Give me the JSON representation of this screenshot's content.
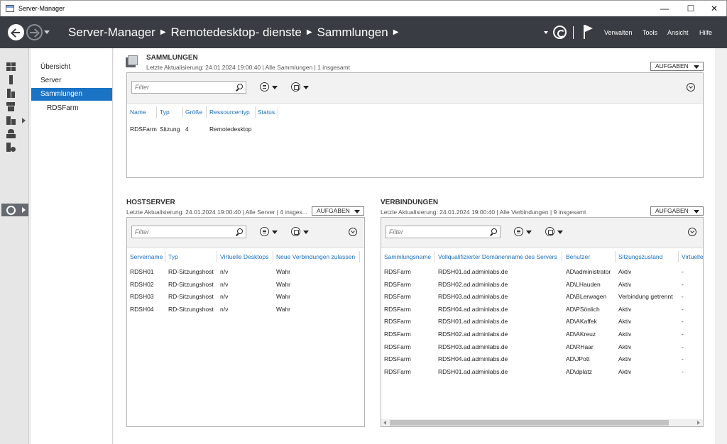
{
  "window": {
    "title": "Server-Manager",
    "minimize": "—",
    "maximize": "☐",
    "close": "✕"
  },
  "header": {
    "breadcrumb": [
      "Server-Manager",
      "Remotedesktop- dienste",
      "Sammlungen"
    ],
    "menus": [
      "Verwalten",
      "Tools",
      "Ansicht",
      "Hilfe"
    ]
  },
  "leftnav": {
    "items": [
      {
        "label": "Übersicht",
        "selected": false
      },
      {
        "label": "Server",
        "selected": false
      },
      {
        "label": "Sammlungen",
        "selected": true
      },
      {
        "label": "RDSFarm",
        "selected": false,
        "sub": true
      }
    ]
  },
  "sammlungen": {
    "title": "SAMMLUNGEN",
    "subtitle": "Letzte Aktualisierung: 24.01.2024 19:00:40 | Alle Sammlungen  | 1 insgesamt",
    "tasks": "AUFGABEN",
    "filter_placeholder": "Filter",
    "columns": [
      "Name",
      "Typ",
      "Größe",
      "Ressourcentyp",
      "Status"
    ],
    "rows": [
      [
        "RDSFarm",
        "Sitzung",
        "4",
        "Remotedesktop",
        ""
      ]
    ]
  },
  "hostserver": {
    "title": "HOSTSERVER",
    "subtitle": "Letzte Aktualisierung: 24.01.2024 19:00:40 | Alle Server  | 4 insges...",
    "tasks": "AUFGABEN",
    "filter_placeholder": "Filter",
    "columns": [
      "Servername",
      "Typ",
      "Virtuelle Desktops",
      "Neue Verbindungen zulassen"
    ],
    "rows": [
      [
        "RDSH01",
        "RD-Sitzungshost",
        "n/v",
        "Wahr"
      ],
      [
        "RDSH02",
        "RD-Sitzungshost",
        "n/v",
        "Wahr"
      ],
      [
        "RDSH03",
        "RD-Sitzungshost",
        "n/v",
        "Wahr"
      ],
      [
        "RDSH04",
        "RD-Sitzungshost",
        "n/v",
        "Wahr"
      ]
    ]
  },
  "verbindungen": {
    "title": "VERBINDUNGEN",
    "subtitle": "Letzte Aktualisierung: 24.01.2024 19:00:40 | Alle Verbindungen  | 9 insgesamt",
    "tasks": "AUFGABEN",
    "filter_placeholder": "Filter",
    "columns": [
      "Sammlungsname",
      "Vollqualifizierter Domänenname des Servers",
      "Benutzer",
      "Sitzungszustand",
      "Virtuelle"
    ],
    "rows": [
      [
        "RDSFarm",
        "RDSH01.ad.adminlabs.de",
        "AD\\administrator",
        "Aktiv",
        "-"
      ],
      [
        "RDSFarm",
        "RDSH02.ad.adminlabs.de",
        "AD\\LHauden",
        "Aktiv",
        "-"
      ],
      [
        "RDSFarm",
        "RDSH03.ad.adminlabs.de",
        "AD\\BLerwagen",
        "Verbindung getrennt",
        "-"
      ],
      [
        "RDSFarm",
        "RDSH04.ad.adminlabs.de",
        "AD\\PSönlich",
        "Aktiv",
        "-"
      ],
      [
        "RDSFarm",
        "RDSH01.ad.adminlabs.de",
        "AD\\AKaffek",
        "Aktiv",
        "-"
      ],
      [
        "RDSFarm",
        "RDSH02.ad.adminlabs.de",
        "AD\\AKreuz",
        "Aktiv",
        "-"
      ],
      [
        "RDSFarm",
        "RDSH03.ad.adminlabs.de",
        "AD\\RHaar",
        "Aktiv",
        "-"
      ],
      [
        "RDSFarm",
        "RDSH04.ad.adminlabs.de",
        "AD\\JPott",
        "Aktiv",
        "-"
      ],
      [
        "RDSFarm",
        "RDSH01.ad.adminlabs.de",
        "AD\\dplatz",
        "Aktiv",
        "-"
      ]
    ]
  }
}
